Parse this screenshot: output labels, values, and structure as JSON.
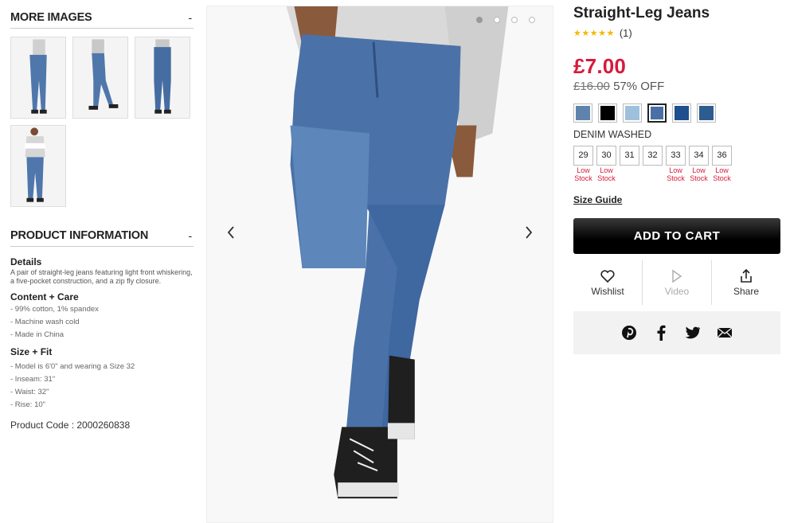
{
  "left": {
    "more_images": {
      "title": "MORE IMAGES",
      "toggle": "-"
    },
    "product_info": {
      "title": "PRODUCT INFORMATION",
      "toggle": "-",
      "details_title": "Details",
      "details_text": "A pair of straight-leg jeans featuring light front whiskering, a five-pocket construction, and a zip fly closure.",
      "content_title": "Content + Care",
      "content_items": [
        "- 99% cotton, 1% spandex",
        "- Machine wash cold",
        "- Made in China"
      ],
      "size_title": "Size + Fit",
      "size_items": [
        "- Model is 6'0\" and wearing a Size 32",
        "- Inseam: 31\"",
        "- Waist: 32\"",
        "- Rise: 10\""
      ],
      "product_code": "Product Code : 2000260838"
    }
  },
  "product": {
    "title": "Straight-Leg Jeans",
    "stars": "★★★★★",
    "review_count": "(1)",
    "price": "£7.00",
    "original_price": "£16.00",
    "discount": "57% OFF",
    "color_name": "DENIM WASHED",
    "swatches": [
      "#5f83ad",
      "#000000",
      "#9fc0dc",
      "#4a6fa5",
      "#1f4f8c",
      "#2e5c8f"
    ],
    "selected_swatch": 3,
    "sizes": [
      {
        "label": "29",
        "stock": [
          "Low",
          "Stock"
        ]
      },
      {
        "label": "30",
        "stock": [
          "Low",
          "Stock"
        ]
      },
      {
        "label": "31",
        "stock": []
      },
      {
        "label": "32",
        "stock": []
      },
      {
        "label": "33",
        "stock": [
          "Low",
          "Stock"
        ]
      },
      {
        "label": "34",
        "stock": [
          "Low",
          "Stock"
        ]
      },
      {
        "label": "36",
        "stock": [
          "Low",
          "Stock"
        ]
      }
    ],
    "size_guide": "Size Guide",
    "add_to_cart": "ADD TO CART",
    "actions": {
      "wishlist": "Wishlist",
      "video": "Video",
      "share": "Share"
    },
    "share_icons": [
      "pinterest-icon",
      "facebook-icon",
      "twitter-icon",
      "email-icon"
    ]
  },
  "gallery": {
    "arrow_prev": "‹",
    "arrow_next": "›",
    "dot_count": 4,
    "active_dot": 0
  },
  "colors": {
    "accent": "#d71a3d",
    "denim": "#4a72a8"
  }
}
